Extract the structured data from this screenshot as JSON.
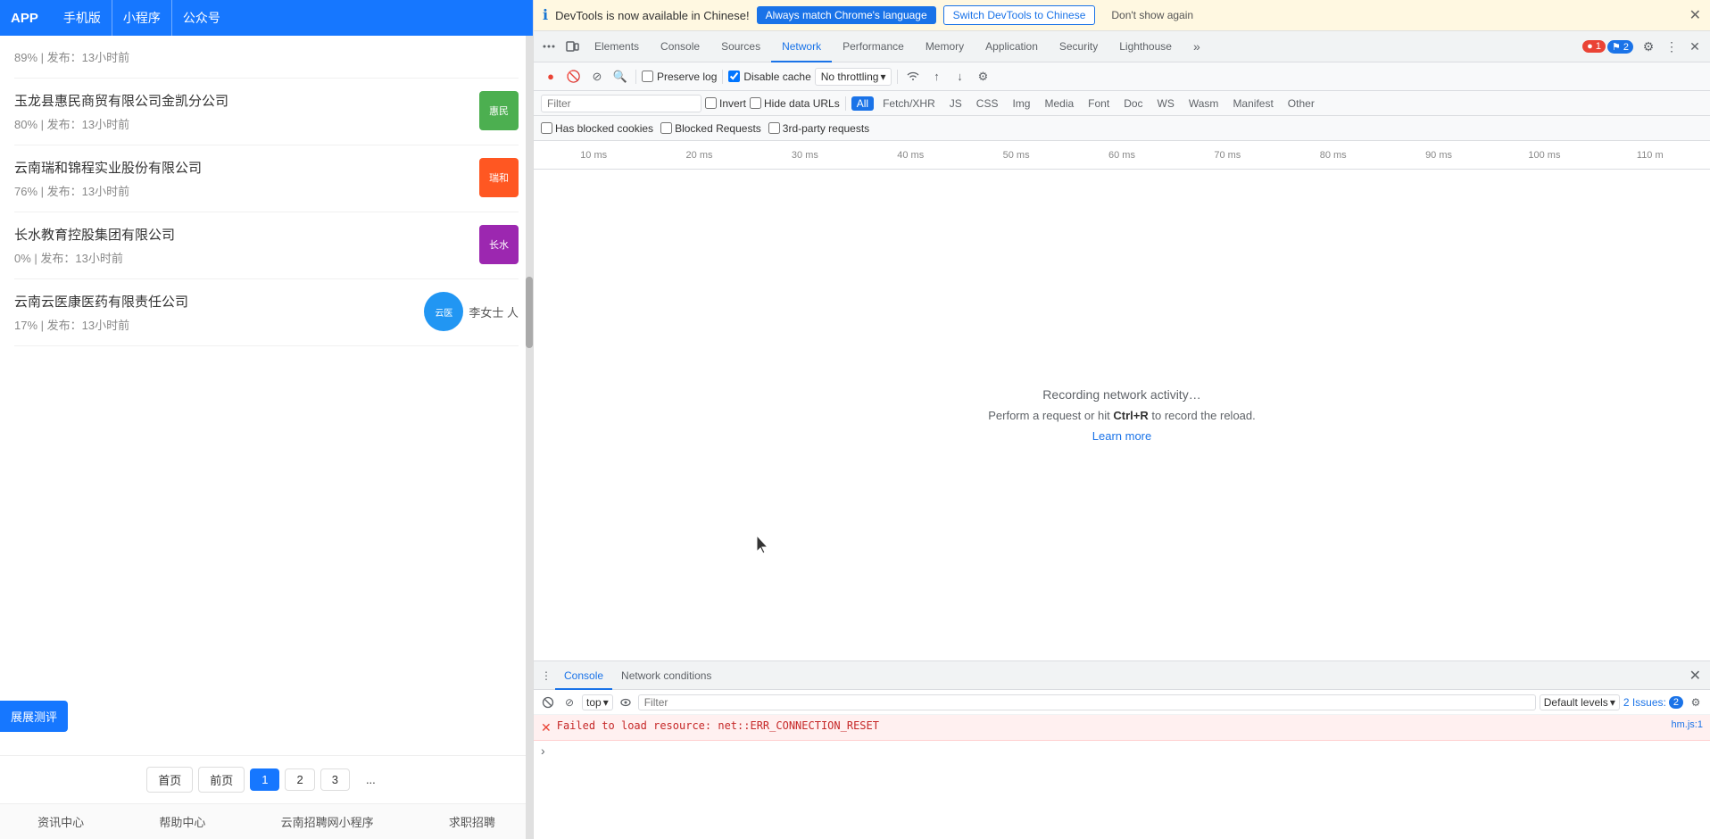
{
  "left": {
    "nav": {
      "logo": "APP",
      "items": [
        "手机版",
        "小程序",
        "公众号"
      ]
    },
    "companies": [
      {
        "name": "玉龙县惠民商贸有限公司金凯分公司",
        "meta": "80% | 发布：13小时前",
        "logo_color": "#4caf50",
        "logo_text": "惠民"
      },
      {
        "name": "云南瑞和锦程实业股份有限公司",
        "meta": "76% | 发布：13小时前",
        "logo_color": "#ff5722",
        "logo_text": "瑞和"
      },
      {
        "name": "长水教育控股集团有限公司",
        "meta": "0% | 发布：13小时前",
        "logo_color": "#9c27b0",
        "logo_text": "长水"
      },
      {
        "name": "云南云医康医药有限责任公司",
        "meta": "17% | 发布：13小时前",
        "logo_color": "#2196f3",
        "logo_text": "云医",
        "extra": "李女士  人"
      }
    ],
    "first_item_meta": "89% | 发布：13小时前",
    "evaluate_btn": "展展测评",
    "pagination": {
      "first": "首页",
      "prev": "前页",
      "pages": [
        "1",
        "2",
        "3"
      ],
      "dots": "...",
      "current": "1"
    },
    "footer_links": [
      "资讯中心",
      "帮助中心",
      "云南招聘网小程序",
      "求职招聘"
    ]
  },
  "devtools": {
    "info_bar": {
      "icon": "ℹ",
      "text": "DevTools is now available in Chinese!",
      "btn_match": "Always match Chrome's language",
      "btn_switch": "Switch DevTools to Chinese",
      "btn_dont_show": "Don't show again"
    },
    "tabs": [
      "Elements",
      "Console",
      "Sources",
      "Network",
      "Performance",
      "Memory",
      "Application",
      "Security",
      "Lighthouse"
    ],
    "active_tab": "Network",
    "tab_icons_left": [
      "customize-icon",
      "device-icon"
    ],
    "error_count": "1",
    "warning_count": "2",
    "toolbar": {
      "record": "●",
      "clear": "🚫",
      "filter": "⊘",
      "search": "🔍",
      "preserve_log_label": "Preserve log",
      "disable_cache_checked": true,
      "disable_cache_label": "Disable cache",
      "throttle_label": "No throttling",
      "wifi_icon": "wifi",
      "upload_icon": "↑",
      "download_icon": "↓"
    },
    "filter_bar": {
      "filter_label": "Filter",
      "invert_label": "Invert",
      "hide_data_urls_label": "Hide data URLs",
      "types": [
        "All",
        "Fetch/XHR",
        "JS",
        "CSS",
        "Img",
        "Media",
        "Font",
        "Doc",
        "WS",
        "Wasm",
        "Manifest",
        "Other"
      ],
      "active_type": "All"
    },
    "filter_bar2": {
      "has_blocked_cookies": "Has blocked cookies",
      "blocked_requests": "Blocked Requests",
      "third_party": "3rd-party requests"
    },
    "timeline": {
      "ticks": [
        "10 ms",
        "20 ms",
        "30 ms",
        "40 ms",
        "50 ms",
        "60 ms",
        "70 ms",
        "80 ms",
        "90 ms",
        "100 ms",
        "110 m"
      ]
    },
    "network_empty": {
      "recording": "Recording network activity…",
      "desc_prefix": "Perform a request or hit ",
      "shortcut": "Ctrl+R",
      "desc_suffix": " to record the reload.",
      "learn_more": "Learn more"
    },
    "console": {
      "tabs": [
        "Console",
        "Network conditions"
      ],
      "active_tab": "Console",
      "toolbar": {
        "top_label": "top",
        "filter_placeholder": "Filter",
        "levels_label": "Default levels",
        "issues_label": "2 Issues:",
        "issues_count": "2"
      },
      "error": {
        "message": "Failed to load resource: net::ERR_CONNECTION_RESET",
        "source": "hm.js:1"
      }
    }
  }
}
